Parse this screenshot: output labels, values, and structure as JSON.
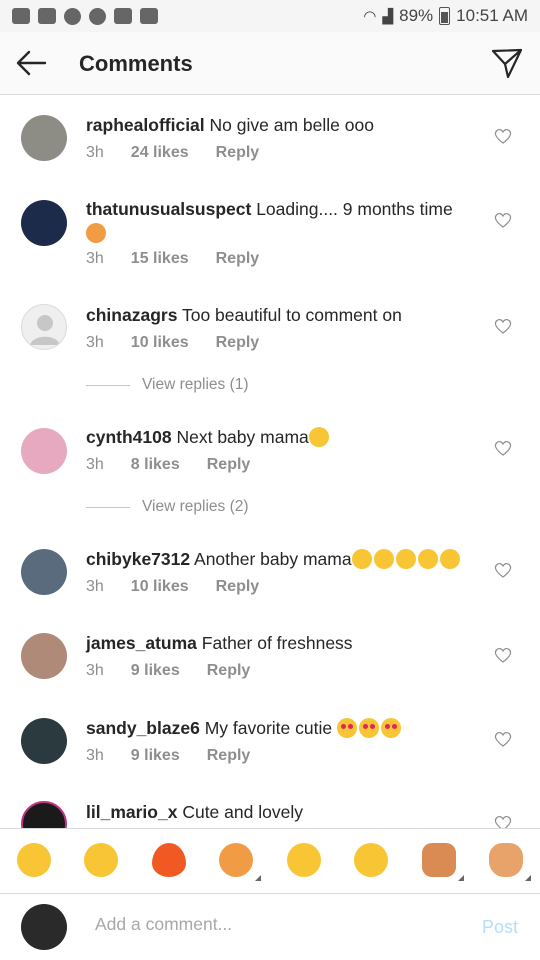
{
  "status_bar": {
    "battery": "89%",
    "time": "10:51 AM"
  },
  "header": {
    "title": "Comments"
  },
  "comments": [
    {
      "user": "raphealofficial",
      "text": "No give am belle ooo",
      "age": "3h",
      "likes": "24 likes",
      "reply": "Reply"
    },
    {
      "user": "thatunusualsuspect",
      "text": "Loading.... 9 months time",
      "age": "3h",
      "likes": "15 likes",
      "reply": "Reply"
    },
    {
      "user": "chinazagrs",
      "text": "Too beautiful to comment on",
      "age": "3h",
      "likes": "10 likes",
      "reply": "Reply",
      "view_replies": "View replies (1)"
    },
    {
      "user": "cynth4108",
      "text": "Next baby mama",
      "age": "3h",
      "likes": "8 likes",
      "reply": "Reply",
      "view_replies": "View replies (2)"
    },
    {
      "user": "chibyke7312",
      "text": "Another baby mama",
      "age": "3h",
      "likes": "10 likes",
      "reply": "Reply"
    },
    {
      "user": "james_atuma",
      "text": "Father of freshness",
      "age": "3h",
      "likes": "9 likes",
      "reply": "Reply"
    },
    {
      "user": "sandy_blaze6",
      "text": "My favorite cutie",
      "age": "3h",
      "likes": "9 likes",
      "reply": "Reply"
    },
    {
      "user": "lil_mario_x",
      "text": "Cute and lovely"
    }
  ],
  "emoji_bar": [
    "rofl-emoji",
    "joy-emoji",
    "fire-emoji",
    "baby-emoji",
    "grin-emoji",
    "woozy-emoji",
    "fist-emoji",
    "ok-hand-emoji"
  ],
  "composer": {
    "placeholder": "Add a comment...",
    "post_label": "Post"
  },
  "colors": {
    "accent_disabled": "#b2dffc",
    "secondary_text": "#8e8e8e",
    "emoji_yellow": "#f8c534"
  }
}
